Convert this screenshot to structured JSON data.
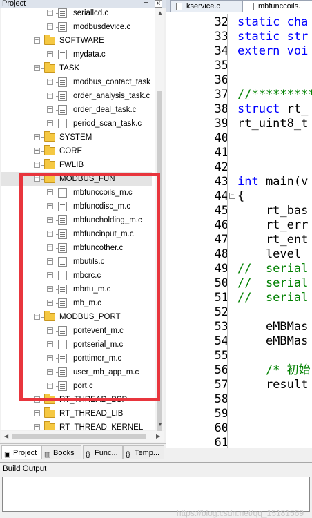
{
  "project": {
    "title": "Project",
    "pin": "p",
    "close": "×",
    "tree": [
      {
        "label": "seriallcd.c",
        "type": "file",
        "level": 2
      },
      {
        "label": "modbusdevice.c",
        "type": "file",
        "level": 2
      },
      {
        "label": "SOFTWARE",
        "type": "folder",
        "level": 1,
        "expanded": true
      },
      {
        "label": "mydata.c",
        "type": "file",
        "level": 2
      },
      {
        "label": "TASK",
        "type": "folder",
        "level": 1,
        "expanded": true
      },
      {
        "label": "modbus_contact_task",
        "type": "file",
        "level": 2
      },
      {
        "label": "order_analysis_task.c",
        "type": "file",
        "level": 2
      },
      {
        "label": "order_deal_task.c",
        "type": "file",
        "level": 2
      },
      {
        "label": "period_scan_task.c",
        "type": "file",
        "level": 2
      },
      {
        "label": "SYSTEM",
        "type": "folder",
        "level": 1,
        "expanded": false
      },
      {
        "label": "CORE",
        "type": "folder",
        "level": 1,
        "expanded": false
      },
      {
        "label": "FWLIB",
        "type": "folder",
        "level": 1,
        "expanded": false
      },
      {
        "label": "MODBUS_FUN",
        "type": "folder",
        "level": 1,
        "expanded": true,
        "selected": true
      },
      {
        "label": "mbfunccoils_m.c",
        "type": "file",
        "level": 2
      },
      {
        "label": "mbfuncdisc_m.c",
        "type": "file",
        "level": 2
      },
      {
        "label": "mbfuncholding_m.c",
        "type": "file",
        "level": 2
      },
      {
        "label": "mbfuncinput_m.c",
        "type": "file",
        "level": 2
      },
      {
        "label": "mbfuncother.c",
        "type": "file",
        "level": 2
      },
      {
        "label": "mbutils.c",
        "type": "file",
        "level": 2
      },
      {
        "label": "mbcrc.c",
        "type": "file",
        "level": 2
      },
      {
        "label": "mbrtu_m.c",
        "type": "file",
        "level": 2
      },
      {
        "label": "mb_m.c",
        "type": "file",
        "level": 2
      },
      {
        "label": "MODBUS_PORT",
        "type": "folder",
        "level": 1,
        "expanded": true
      },
      {
        "label": "portevent_m.c",
        "type": "file",
        "level": 2
      },
      {
        "label": "portserial_m.c",
        "type": "file",
        "level": 2
      },
      {
        "label": "porttimer_m.c",
        "type": "file",
        "level": 2
      },
      {
        "label": "user_mb_app_m.c",
        "type": "file",
        "level": 2
      },
      {
        "label": "port.c",
        "type": "file",
        "level": 2
      },
      {
        "label": "RT_THREAD_BSP",
        "type": "folder",
        "level": 1,
        "expanded": false
      },
      {
        "label": "RT_THREAD_LIB",
        "type": "folder",
        "level": 1,
        "expanded": false
      },
      {
        "label": "RT_THREAD_KERNEL",
        "type": "folder",
        "level": 1,
        "expanded": false
      }
    ],
    "tabs": [
      {
        "label": "Project",
        "icon": "project-icon",
        "active": true
      },
      {
        "label": "Books",
        "icon": "books-icon",
        "active": false
      },
      {
        "label": "Func...",
        "icon": "functions-icon",
        "active": false
      },
      {
        "label": "Temp...",
        "icon": "templates-icon",
        "active": false
      }
    ]
  },
  "editor": {
    "tabs": [
      {
        "label": "kservice.c",
        "active": false
      },
      {
        "label": "mbfunccoils.",
        "active": true
      }
    ],
    "lines": [
      {
        "n": "32",
        "segs": [
          {
            "c": "kw",
            "t": "static cha"
          }
        ]
      },
      {
        "n": "33",
        "segs": [
          {
            "c": "kw",
            "t": "static str"
          }
        ]
      },
      {
        "n": "34",
        "segs": [
          {
            "c": "kw",
            "t": "extern voi"
          }
        ]
      },
      {
        "n": "35",
        "segs": []
      },
      {
        "n": "36",
        "segs": []
      },
      {
        "n": "37",
        "segs": [
          {
            "c": "cm",
            "t": "//*********"
          }
        ]
      },
      {
        "n": "38",
        "segs": [
          {
            "c": "kw",
            "t": "struct"
          },
          {
            "c": "tx",
            "t": " rt_"
          }
        ]
      },
      {
        "n": "39",
        "segs": [
          {
            "c": "tx",
            "t": "rt_uint8_t"
          }
        ]
      },
      {
        "n": "40",
        "segs": []
      },
      {
        "n": "41",
        "segs": []
      },
      {
        "n": "42",
        "segs": []
      },
      {
        "n": "43",
        "segs": [
          {
            "c": "kw",
            "t": "int"
          },
          {
            "c": "tx",
            "t": " main(v"
          }
        ]
      },
      {
        "n": "44",
        "segs": [
          {
            "c": "tx",
            "t": "{"
          }
        ]
      },
      {
        "n": "45",
        "segs": [
          {
            "c": "tx",
            "t": "    rt_bas"
          }
        ]
      },
      {
        "n": "46",
        "segs": [
          {
            "c": "tx",
            "t": "    rt_err"
          }
        ]
      },
      {
        "n": "47",
        "segs": [
          {
            "c": "tx",
            "t": "    rt_ent"
          }
        ]
      },
      {
        "n": "48",
        "segs": [
          {
            "c": "tx",
            "t": "    level"
          }
        ]
      },
      {
        "n": "49",
        "segs": [
          {
            "c": "cm",
            "t": "//  serial"
          }
        ]
      },
      {
        "n": "50",
        "segs": [
          {
            "c": "cm",
            "t": "//  serial"
          }
        ]
      },
      {
        "n": "51",
        "segs": [
          {
            "c": "cm",
            "t": "//  serial"
          }
        ]
      },
      {
        "n": "52",
        "segs": []
      },
      {
        "n": "53",
        "segs": [
          {
            "c": "tx",
            "t": "    eMBMas"
          }
        ]
      },
      {
        "n": "54",
        "segs": [
          {
            "c": "tx",
            "t": "    eMBMas"
          }
        ]
      },
      {
        "n": "55",
        "segs": []
      },
      {
        "n": "56",
        "segs": [
          {
            "c": "cm",
            "t": "    /* 初始"
          }
        ]
      },
      {
        "n": "57",
        "segs": [
          {
            "c": "tx",
            "t": "    result"
          }
        ]
      },
      {
        "n": "58",
        "segs": []
      },
      {
        "n": "59",
        "segs": []
      },
      {
        "n": "60",
        "segs": []
      },
      {
        "n": "61",
        "segs": []
      }
    ]
  },
  "build": {
    "title": "Build Output",
    "watermark": "https://blog.csdn.net/qq_15181569"
  },
  "colors": {
    "highlight": "#e8353d",
    "keyword": "#0000ff",
    "comment": "#008000"
  }
}
